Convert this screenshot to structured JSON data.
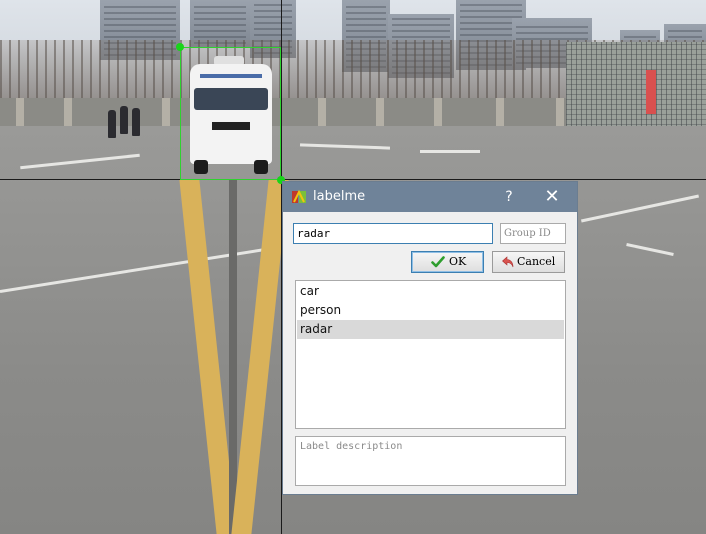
{
  "dialog": {
    "title": "labelme",
    "help_label": "?",
    "close_label": "✕",
    "label_input_value": "radar",
    "group_id_placeholder": "Group ID",
    "ok_label": "OK",
    "cancel_label": "Cancel",
    "description_placeholder": "Label description",
    "labels": [
      {
        "text": "car",
        "selected": false
      },
      {
        "text": "person",
        "selected": false
      },
      {
        "text": "radar",
        "selected": true
      }
    ]
  },
  "annotation": {
    "shape": "rectangle",
    "box_color": "#2fd22f"
  },
  "colors": {
    "titlebar": "#6f8399",
    "selection": "#d9d9d9",
    "focus_border": "#3c7fb1"
  },
  "icons": {
    "app": "labelme-app-icon",
    "ok": "checkmark-icon",
    "cancel": "undo-arrow-icon"
  }
}
